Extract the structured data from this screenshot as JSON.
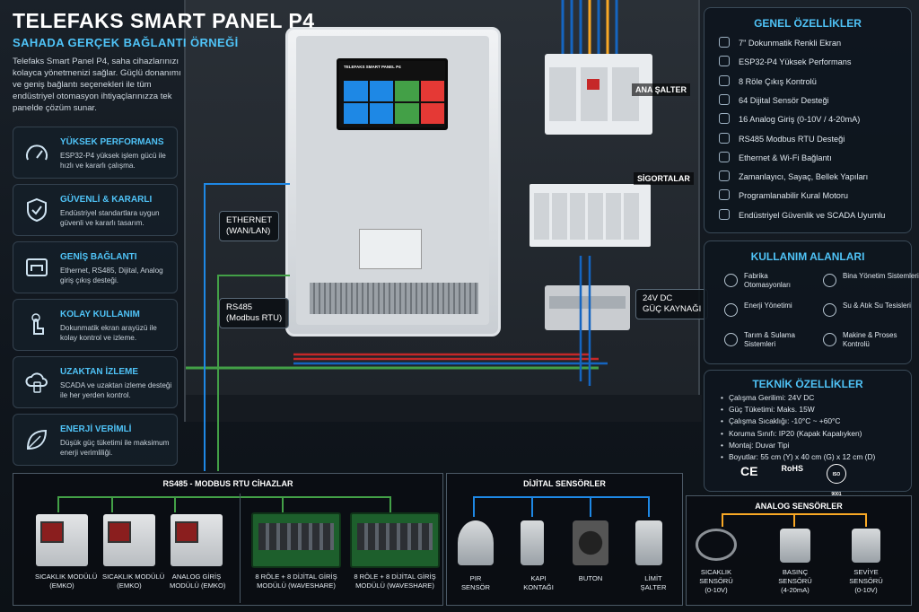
{
  "header": {
    "title": "TELEFAKS SMART PANEL P4",
    "subtitle": "SAHADA GERÇEK BAĞLANTI ÖRNEĞİ",
    "intro": "Telefaks Smart Panel P4, saha cihazlarınızı kolayca yönetmenizi sağlar. Güçlü donanımı ve geniş bağlantı seçenekleri ile tüm endüstriyel otomasyon ihtiyaçlarınızza tek panelde çözüm sunar."
  },
  "features": [
    {
      "icon": "speedometer-icon",
      "title": "YÜKSEK PERFORMANS",
      "desc": "ESP32-P4 yüksek işlem gücü ile hızlı ve kararlı çalışma."
    },
    {
      "icon": "shield-check-icon",
      "title": "GÜVENLİ & KARARLI",
      "desc": "Endüstriyel standartlara uygun güvenli ve kararlı tasarım."
    },
    {
      "icon": "ethernet-port-icon",
      "title": "GENİŞ BAĞLANTI",
      "desc": "Ethernet, RS485, Dijital, Analog giriş çıkış desteği."
    },
    {
      "icon": "hand-touch-icon",
      "title": "KOLAY KULLANIM",
      "desc": "Dokunmatik ekran arayüzü ile kolay kontrol ve izleme."
    },
    {
      "icon": "cloud-device-icon",
      "title": "UZAKTAN İZLEME",
      "desc": "SCADA ve uzaktan izleme desteği ile her yerden kontrol."
    },
    {
      "icon": "leaf-icon",
      "title": "ENERJİ VERİMLİ",
      "desc": "Düşük güç tüketimi ile maksimum enerji verimliliği."
    }
  ],
  "screen": {
    "title": "TELEFAKS SMART PANEL P4",
    "tile_colors": [
      "#1e88e5",
      "#1e88e5",
      "#43a047",
      "#e53935",
      "#1e88e5",
      "#1e88e5",
      "#43a047",
      "#e53935"
    ]
  },
  "cabinet": {
    "main_switch": "ANA ŞALTER",
    "fuses": "SİGORTALAR",
    "psu": "24V DC\nGÜÇ KAYNAĞI",
    "ethernet": "ETHERNET\n(WAN/LAN)",
    "rs485": "RS485\n(Modbus RTU)"
  },
  "general": {
    "title": "GENEL ÖZELLİKLER",
    "items": [
      "7\" Dokunmatik Renkli Ekran",
      "ESP32-P4 Yüksek Performans",
      "8 Röle Çıkış Kontrolü",
      "64 Dijital Sensör Desteği",
      "16 Analog Giriş (0-10V / 4-20mA)",
      "RS485 Modbus RTU Desteği",
      "Ethernet & Wi-Fi Bağlantı",
      "Zamanlayıcı, Sayaç, Bellek Yapıları",
      "Programlanabilir Kural Motoru",
      "Endüstriyel Güvenlik ve SCADA Uyumlu"
    ]
  },
  "usage": {
    "title": "KULLANIM ALANLARI",
    "items": [
      "Fabrika\nOtomasyonları",
      "Bina Yönetim Sistemleri",
      "Enerji Yönetimi",
      "Su & Atık Su Tesisleri",
      "Tarım & Sulama\nSistemleri",
      "Makine & Proses\nKontrolü"
    ]
  },
  "technical": {
    "title": "TEKNİK ÖZELLİKLER",
    "items": [
      "Çalışma Gerilimi: 24V DC",
      "Güç Tüketimi: Maks. 15W",
      "Çalışma Sıcaklığı: -10°C ~ +60°C",
      "Koruma Sınıfı: IP20 (Kapak Kapalıyken)",
      "Montaj: Duvar Tipi",
      "Boyutlar: 55 cm (Y) x 40 cm (G) x 12 cm (D)"
    ],
    "certs": [
      "CE",
      "RoHS",
      "ISO 9001"
    ]
  },
  "rs485": {
    "title": "RS485 - MODBUS RTU CİHAZLAR",
    "devices": [
      "SICAKLIK MODÜLÜ\n(EMKO)",
      "SICAKLIK MODÜLÜ\n(EMKO)",
      "ANALOG GİRİŞ\nMODÜLÜ (EMKO)",
      "8 RÖLE + 8 DİJİTAL GİRİŞ\nMODÜLÜ (WAVESHARE)",
      "8 RÖLE + 8 DİJİTAL GİRİŞ\nMODÜLÜ (WAVESHARE)"
    ]
  },
  "digital": {
    "title": "DİJİTAL SENSÖRLER",
    "devices": [
      "PIR\nSENSÖR",
      "KAPI\nKONTAĞI",
      "BUTON",
      "LİMİT\nŞALTER"
    ]
  },
  "analog": {
    "title": "ANALOG SENSÖRLER",
    "devices": [
      "SICAKLIK\nSENSÖRÜ\n(0-10V)",
      "BASINÇ\nSENSÖRÜ\n(4-20mA)",
      "SEVİYE\nSENSÖRÜ\n(0-10V)"
    ]
  }
}
